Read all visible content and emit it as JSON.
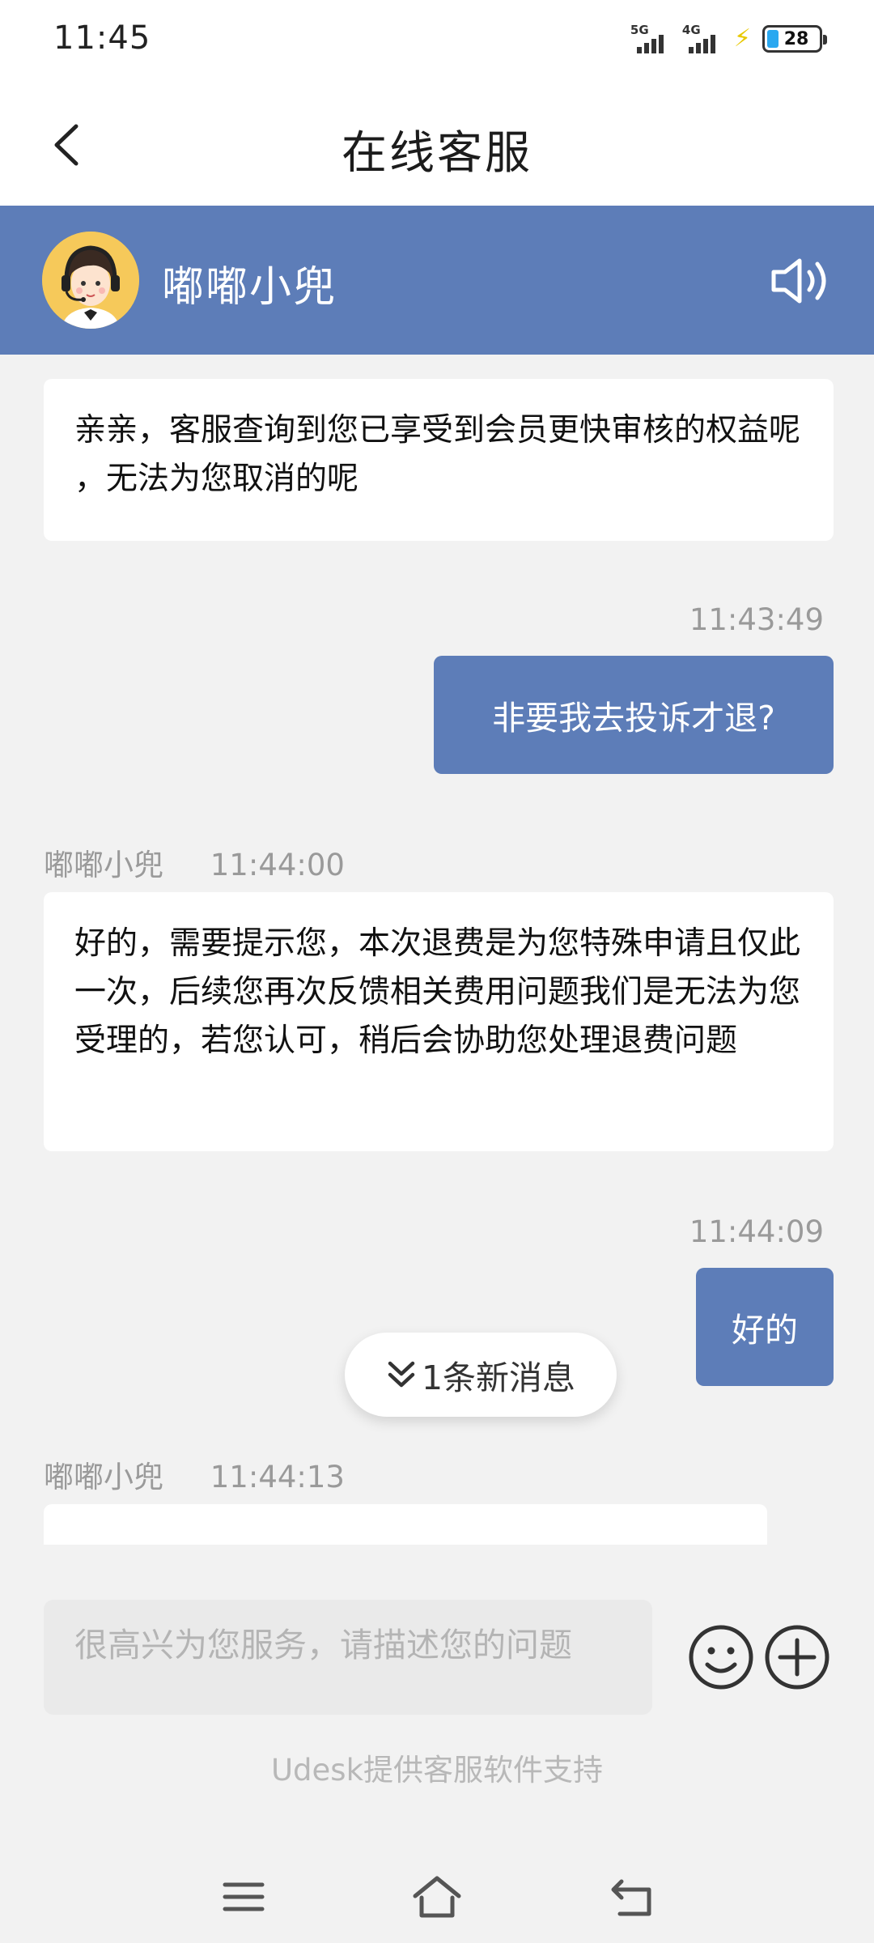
{
  "status_bar": {
    "time": "11:45",
    "network_1": "5G",
    "network_2": "4G",
    "battery_level": "28",
    "battery_color": "#2aa8f0",
    "charging_color": "#e8c800"
  },
  "header": {
    "title": "在线客服",
    "back_icon": "chevron-left-icon"
  },
  "agent": {
    "name": "嘟嘟小兜",
    "avatar": "headset-agent-avatar",
    "speaker_icon": "speaker-volume-icon",
    "bar_color": "#5d7db8"
  },
  "messages": [
    {
      "side": "left",
      "text": "亲亲，客服查询到您已享受到会员更快审核的权益呢 ，无法为您取消的呢"
    },
    {
      "side": "right",
      "time": "11:43:49",
      "text": "非要我去投诉才退?"
    },
    {
      "side": "left",
      "sender": "嘟嘟小兜",
      "time": "11:44:00",
      "text": "好的，需要提示您，本次退费是为您特殊申请且仅此一次，后续您再次反馈相关费用问题我们是无法为您受理的，若您认可，稍后会协助您处理退费问题"
    },
    {
      "side": "right",
      "time": "11:44:09",
      "text": "好的"
    },
    {
      "side": "left",
      "sender": "嘟嘟小兜",
      "time": "11:44:13",
      "text": ""
    }
  ],
  "new_message_pill": {
    "label": "1条新消息",
    "icon": "double-chevron-down-icon"
  },
  "input": {
    "placeholder": "很高兴为您服务，请描述您的问题",
    "emoji_icon": "smiley-icon",
    "add_icon": "plus-circle-icon"
  },
  "footer": {
    "powered_by": "Udesk提供客服软件支持"
  },
  "nav": {
    "icons": [
      "menu-icon",
      "home-icon",
      "back-arrow-icon"
    ]
  }
}
